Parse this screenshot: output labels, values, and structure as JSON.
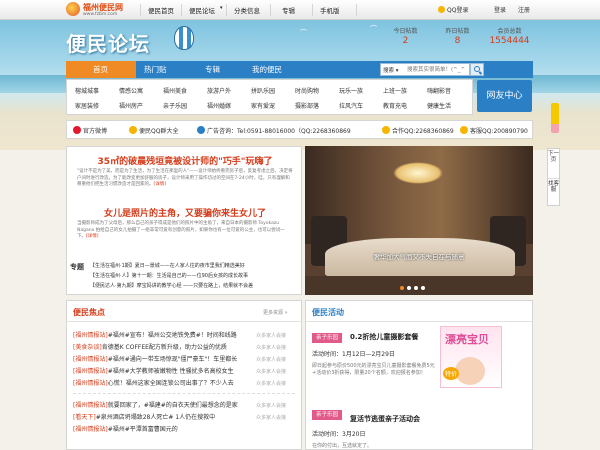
{
  "topbar": {
    "logo_text": "福州便民网",
    "logo_url": "www.fzbm.com",
    "nav": [
      "便民首页",
      "便民论坛",
      "分类信息",
      "专辑",
      "手机版"
    ],
    "qq_login": "QQ登录",
    "login": "登录",
    "register": "注册"
  },
  "hero": {
    "title": "便民论坛",
    "stats": [
      {
        "label": "今日帖数",
        "value": "2"
      },
      {
        "label": "昨日帖数",
        "value": "8"
      },
      {
        "label": "会员总数",
        "value": "1554444"
      }
    ]
  },
  "mainnav": {
    "items": [
      "首页",
      "热门贴",
      "专辑",
      "我的便民"
    ],
    "search_select": "搜索",
    "search_placeholder": "搜索其实很简单！(^_^)"
  },
  "subnav": {
    "row1": [
      "榕城城事",
      "情感公寓",
      "福州美食",
      "旅游户外",
      "拼趴乐园",
      "时尚购物",
      "玩乐一族",
      "上班一族",
      "嗨翻影音"
    ],
    "row2": [
      "家居装修",
      "福州房产",
      "亲子乐园",
      "福州婚嫁",
      "家有爱宠",
      "摄影部落",
      "拉风汽车",
      "教育充电",
      "健康生活"
    ],
    "netfriend": "网友中心"
  },
  "infobar": {
    "weibo": "官方微博",
    "qq_group": "便民QQ群大全",
    "ad_phone": "广告咨询：Tel:0591-88016000（QQ:2268360869",
    "cooperate": "合作QQ:2268360869",
    "service": "客服QQ:200890790"
  },
  "sidebar": {
    "next": "下一页",
    "kefu": "找客服"
  },
  "feature": {
    "headline1": "35㎡的破晨残垣竟被设计师的\"巧手\"玩嗨了",
    "body1": "\"设计不是为了美，而是为了生活，为了生活在那里的人\"——设计师始终看完房子后，反复考虑之后，决定将户间时进行改造。为了能改变更加舒服的房子，设计师采用了操作切过的空间在7-24小时，哇，只有理解和尊重他们把生活习惯改造才是回家的。",
    "more1": "[详情]",
    "headline2": "女儿是照片的主角，又要骗你来生女儿了",
    "body2": "当摄影师成为了父母后，那么自己的孩子得成是他们的照片中的主角了，来自日本的摄影师 Toyokazu Nagano 拍给自己的女儿拍摄了一组非常可爱有创意的照片，如果你也有一位可爱的公主，也可以尝试一下。",
    "more2": "[详情]",
    "topic_label": "专题",
    "topics": [
      "【生活在福州·1期】夏日—景城——在人家人往的夜市里我们精选美好",
      "【生活在福州·人】第十一期：生活是自己的——位90后女孩的成长故事",
      "【便民达人·第九期】摩宝妈讲的教学心经 ——只要在路上，结果就不会差"
    ]
  },
  "slider": {
    "caption": "奢华加大气而又不失自在与随意"
  },
  "focus": {
    "title": "便民焦点",
    "more": "更多资源 »",
    "items": [
      {
        "cat": "[福州情报站]",
        "title": "#福州#宣布！福州公交地铁免费#！时间和线路",
        "author": "众多家人会接"
      },
      {
        "cat": "[美食杂谈]",
        "title": "肯德基K COFFEE配方新升级，助力公益的优质",
        "author": "众多家人会接"
      },
      {
        "cat": "[福州情报站]",
        "title": "#福州#通向一带车场惊现\"僵尸豪车\"！车里都长",
        "author": "众多家人会接"
      },
      {
        "cat": "[福州情报站]",
        "title": "#福州#大学教师被嫩物性 性骚扰多名高校女生",
        "author": "众多家人会接"
      },
      {
        "cat": "[福州情报站]",
        "title": "心慌！福州这家全国连锁公司出事了？不少人去",
        "author": "众多家人会接"
      },
      {
        "cat": "[福州情报站]",
        "title": "就要回家了，#福建#的自衣天使们最想念的是家",
        "author": "众多家人会接"
      },
      {
        "cat": "[看天下]",
        "title": "#泉州酒店坍塌致28人死亡# 1人仍在搜救中",
        "author": "众多家人会接"
      },
      {
        "cat": "[福州情报站]",
        "title": "#福州#平潭首富曹国元的",
        "author": "众多家人会接"
      }
    ]
  },
  "activity": {
    "title": "便民活动",
    "items": [
      {
        "tag": "亲子乐园",
        "title": "0.2折抢儿童摄影套餐",
        "time": "活动时间：1月12日—2月29日",
        "desc": "即日起参与原价500元的漂亮宝贝儿童摄影套餐免费5元+活动价3折获得，限量20个名额，欢迎报名参加！"
      },
      {
        "tag": "亲子乐园",
        "title": "复活节逃蛋亲子活动会",
        "time": "活动时间：3月20日",
        "desc": "在你的付出，互选就定了。"
      }
    ],
    "image_title": "漂亮宝贝",
    "image_badge": "特价"
  },
  "colors": {
    "brand_blue": "#2b7fc4",
    "accent_orange": "#f08a24",
    "headline_red": "#d43c1a"
  }
}
